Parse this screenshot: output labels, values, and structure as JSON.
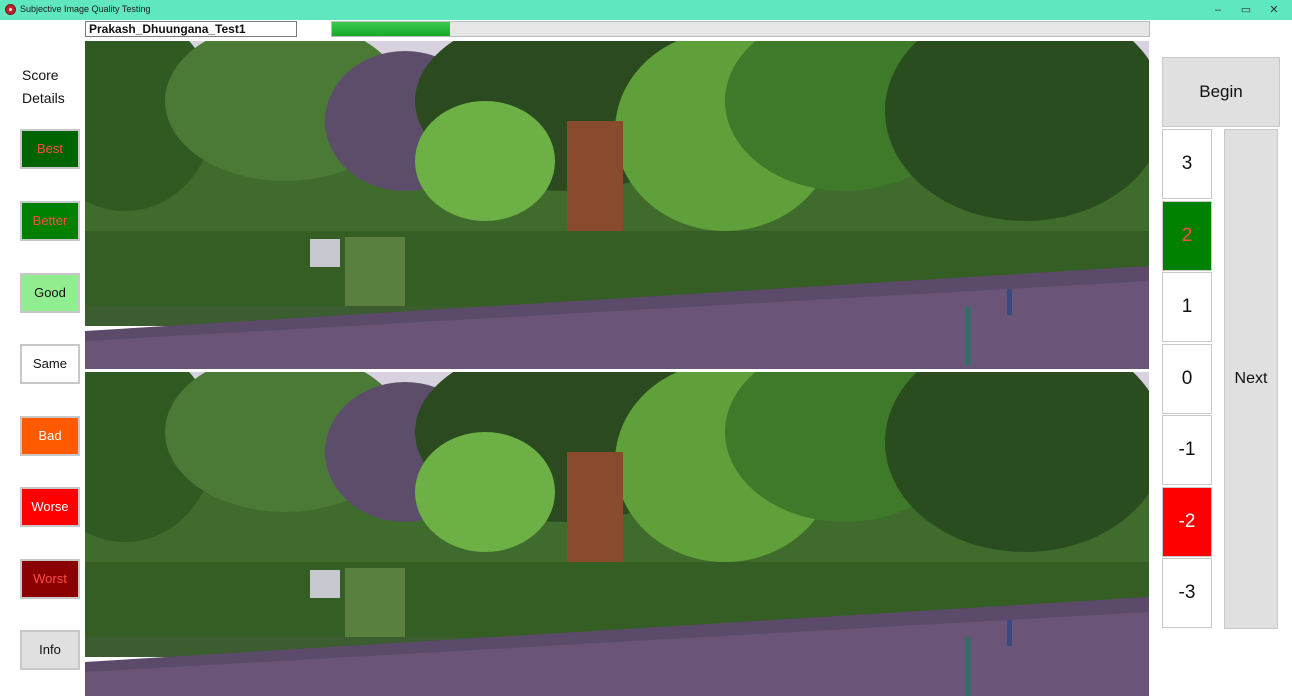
{
  "window": {
    "title": "Subjective Image Quality Testing",
    "controls": {
      "minimize": "–",
      "restore": "▭",
      "close": "✕"
    }
  },
  "header": {
    "test_name": "Prakash_Dhuungana_Test1",
    "progress_fraction": 0.145
  },
  "left_panel": {
    "score_details": "Score Details",
    "buttons": [
      {
        "label": "Best",
        "bg": "#006400",
        "fg": "#ff4a4a"
      },
      {
        "label": "Better",
        "bg": "#008000",
        "fg": "#ff4a4a"
      },
      {
        "label": "Good",
        "bg": "#90ee90",
        "fg": "#111111"
      },
      {
        "label": "Same",
        "bg": "#ffffff",
        "fg": "#111111"
      },
      {
        "label": "Bad",
        "bg": "#ff5a00",
        "fg": "#ffffff"
      },
      {
        "label": "Worse",
        "bg": "#ff0000",
        "fg": "#ffffff"
      },
      {
        "label": "Worst",
        "bg": "#8b0000",
        "fg": "#ff4a4a"
      },
      {
        "label": "Info",
        "bg": "#e0e0e0",
        "fg": "#111111"
      }
    ]
  },
  "right_panel": {
    "begin_label": "Begin",
    "next_label": "Next",
    "scores": [
      {
        "label": "3",
        "bg": "#ffffff",
        "fg": "#111111"
      },
      {
        "label": "2",
        "bg": "#008000",
        "fg": "#ff4a4a"
      },
      {
        "label": "1",
        "bg": "#ffffff",
        "fg": "#111111"
      },
      {
        "label": "0",
        "bg": "#ffffff",
        "fg": "#111111"
      },
      {
        "label": "-1",
        "bg": "#ffffff",
        "fg": "#111111"
      },
      {
        "label": "-2",
        "bg": "#ff0000",
        "fg": "#ffffff"
      },
      {
        "label": "-3",
        "bg": "#ffffff",
        "fg": "#111111"
      }
    ]
  },
  "images": {
    "top": "park-scene-image-a",
    "bottom": "park-scene-image-b"
  }
}
